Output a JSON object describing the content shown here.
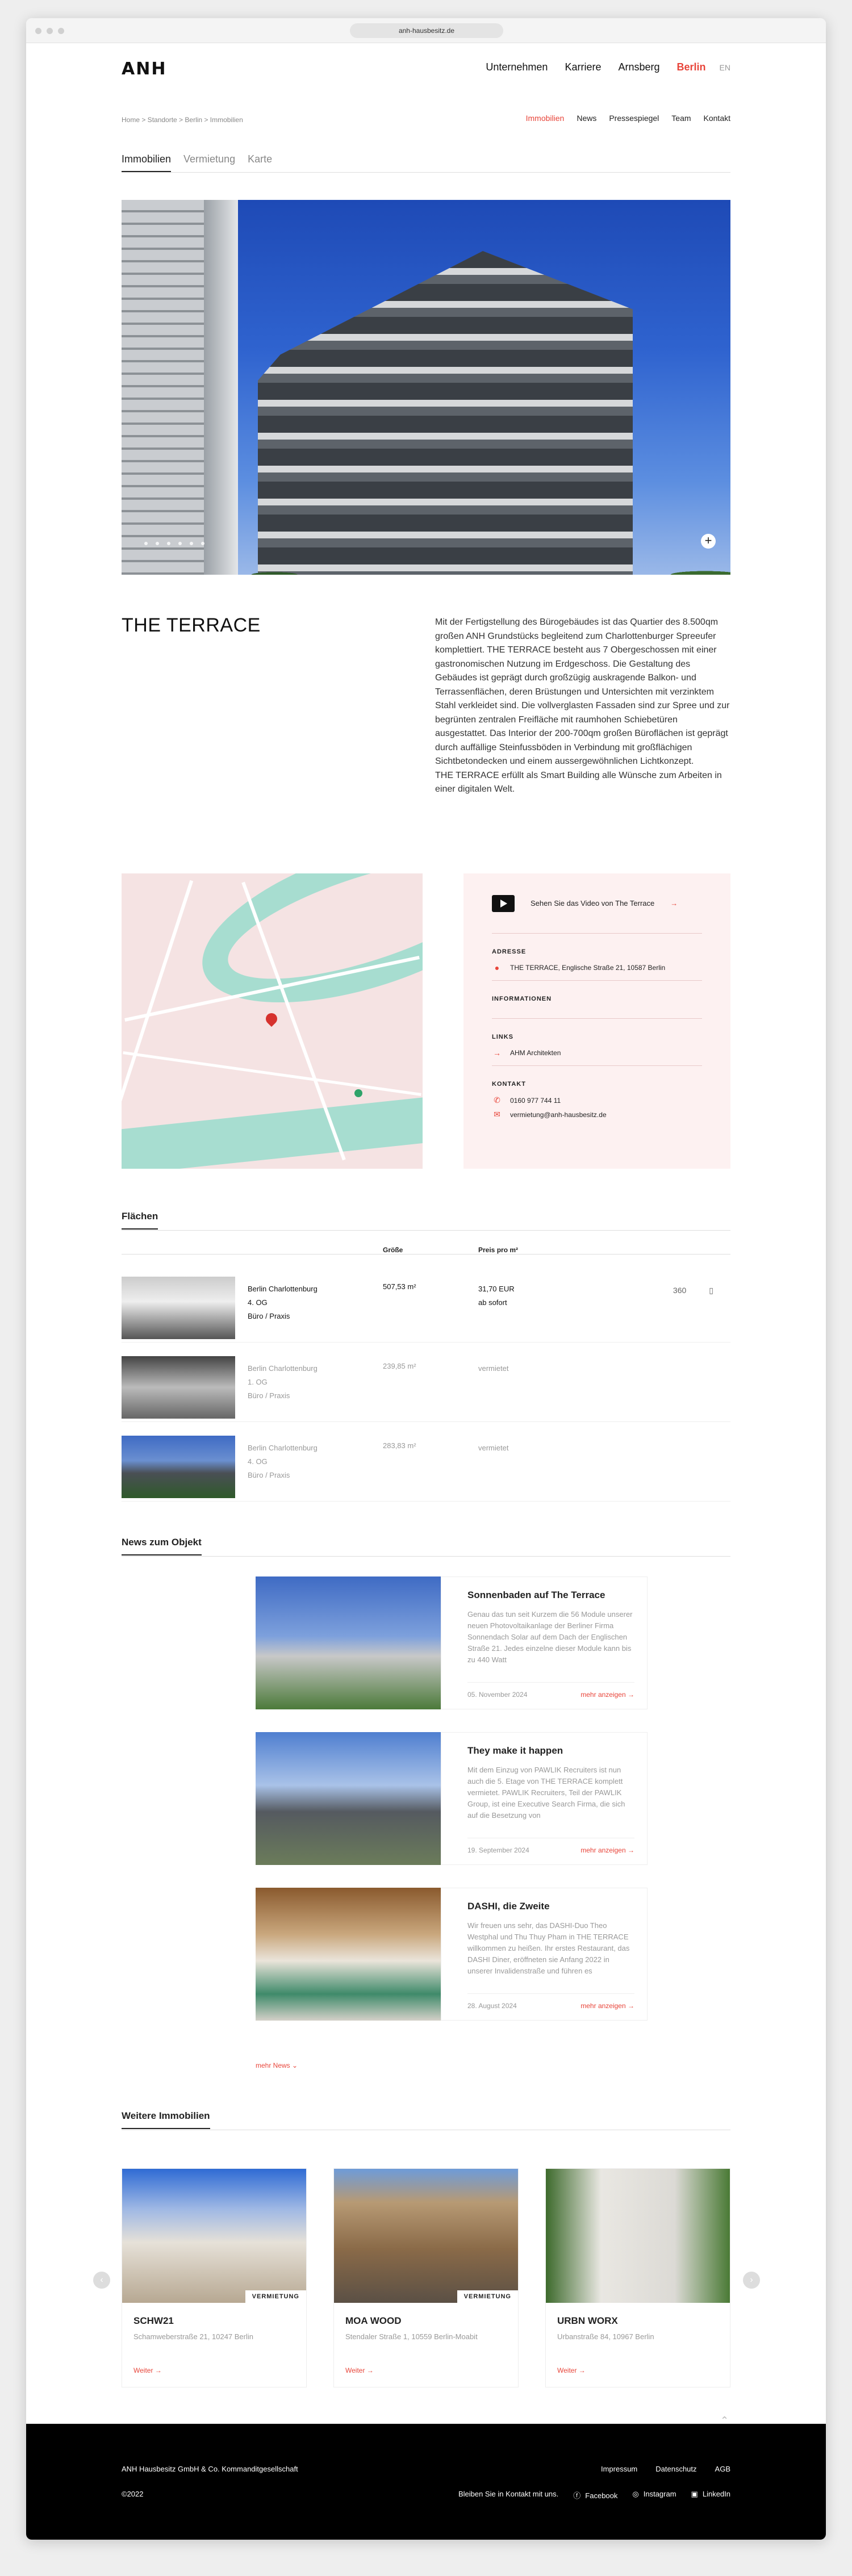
{
  "browser": {
    "url": "anh-hausbesitz.de"
  },
  "header": {
    "logo": "ANH",
    "nav": [
      {
        "label": "Unternehmen"
      },
      {
        "label": "Karriere"
      },
      {
        "label": "Arnsberg"
      },
      {
        "label": "Berlin"
      }
    ],
    "lang": "EN"
  },
  "breadcrumb": "Home > Standorte > Berlin > Immobilien",
  "subnav": [
    "Immobilien",
    "News",
    "Pressespiegel",
    "Team",
    "Kontakt"
  ],
  "tabs": [
    "Immobilien",
    "Vermietung",
    "Karte"
  ],
  "property": {
    "title": "THE TERRACE",
    "description_1": "Mit der Fertigstellung des Bürogebäudes ist das Quartier des 8.500qm großen ANH Grundstücks begleitend zum Charlottenburger Spreeufer komplettiert. THE TERRACE besteht aus 7 Obergeschossen mit einer gastronomischen Nutzung im Erdgeschoss. Die Gestaltung des Gebäudes ist geprägt durch großzügig auskragende Balkon- und Terrassenflächen, deren Brüstungen und Untersichten mit verzinktem Stahl verkleidet sind. Die vollverglasten Fassaden sind zur Spree und zur begrünten zentralen Freifläche mit raumhohen Schiebetüren ausgestattet. Das Interior der 200-700qm großen Büroflächen ist geprägt durch auffällige Steinfussböden in Verbindung mit großflächigen Sichtbetondecken und einem aussergewöhnlichen Lichtkonzept.",
    "description_2": "THE TERRACE erfüllt als Smart Building alle Wünsche zum Arbeiten in einer digitalen Welt."
  },
  "info": {
    "video_label": "Sehen Sie das Video von The Terrace",
    "adresse_label": "ADRESSE",
    "adresse": "THE TERRACE, Englische Straße 21, 10587 Berlin",
    "informationen_label": "INFORMATIONEN",
    "links_label": "LINKS",
    "link_1": "AHM Architekten",
    "kontakt_label": "KONTAKT",
    "phone": "0160 977 744 11",
    "email": "vermietung@anh-hausbesitz.de"
  },
  "flaechen": {
    "title": "Flächen",
    "col_size": "Größe",
    "col_price": "Preis pro m²",
    "rows": [
      {
        "loc": "Berlin Charlottenburg",
        "floor": "4. OG",
        "use": "Büro / Praxis",
        "size": "507,53 m²",
        "price": "31,70 EUR",
        "avail": "ab sofort"
      },
      {
        "loc": "Berlin Charlottenburg",
        "floor": "1. OG",
        "use": "Büro / Praxis",
        "size": "239,85 m²",
        "price": "vermietet",
        "avail": ""
      },
      {
        "loc": "Berlin Charlottenburg",
        "floor": "4. OG",
        "use": "Büro / Praxis",
        "size": "283,83 m²",
        "price": "vermietet",
        "avail": ""
      }
    ],
    "tour_label": "360"
  },
  "news": {
    "title": "News zum Objekt",
    "items": [
      {
        "title": "Sonnenbaden auf The Terrace",
        "text": "Genau das tun seit Kurzem die 56 Module unserer neuen Photovoltaikanlage der Berliner Firma Sonnendach Solar auf dem Dach der Englischen Straße 21. Jedes einzelne dieser Module kann bis zu 440 Watt",
        "date": "05. November 2024",
        "more": "mehr anzeigen"
      },
      {
        "title": "They make it happen",
        "text": "Mit dem Einzug von PAWLIK Recruiters ist nun auch die 5. Etage von THE TERRACE komplett vermietet. PAWLIK Recruiters, Teil der PAWLIK Group, ist eine Executive Search Firma, die sich auf die Besetzung von",
        "date": "19. September 2024",
        "more": "mehr anzeigen"
      },
      {
        "title": "DASHI, die Zweite",
        "text": "Wir freuen uns sehr, das DASHI-Duo Theo Westphal und Thu Thuy Pham in THE TERRACE willkommen zu heißen. Ihr erstes Restaurant, das DASHI Diner, eröffneten sie Anfang 2022 in unserer Invalidenstraße und führen es",
        "date": "28. August 2024",
        "more": "mehr anzeigen"
      }
    ],
    "more_news": "mehr News"
  },
  "weitere": {
    "title": "Weitere Immobilien",
    "items": [
      {
        "name": "SCHW21",
        "addr": "Schamweberstraße 21, 10247 Berlin",
        "badge": "VERMIETUNG",
        "more": "Weiter"
      },
      {
        "name": "MOA WOOD",
        "addr": "Stendaler Straße 1, 10559 Berlin-Moabit",
        "badge": "VERMIETUNG",
        "more": "Weiter"
      },
      {
        "name": "URBN WORX",
        "addr": "Urbanstraße 84, 10967 Berlin",
        "badge": "",
        "more": "Weiter"
      }
    ]
  },
  "footer": {
    "company": "ANH Hausbesitz GmbH & Co. Kommanditgesellschaft",
    "copyright": "©2022",
    "links": [
      "Impressum",
      "Datenschutz",
      "AGB"
    ],
    "contact": "Bleiben Sie in Kontakt mit uns.",
    "social": [
      "Facebook",
      "Instagram",
      "LinkedIn"
    ]
  },
  "colors": {
    "accent": "#e8453a",
    "info_bg": "#fdf1f1",
    "footer_bg": "#000000"
  }
}
